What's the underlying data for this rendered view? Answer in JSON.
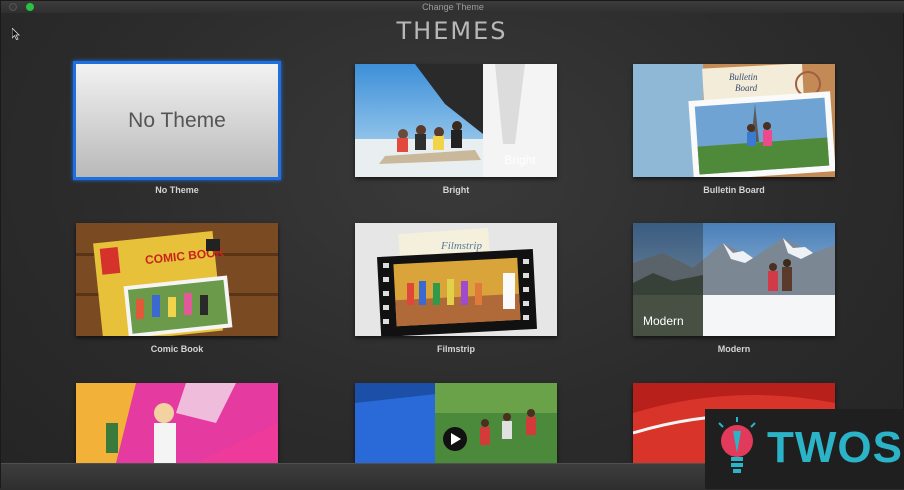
{
  "window": {
    "title": "Change Theme"
  },
  "heading": "THEMES",
  "themes": [
    {
      "label": "No Theme",
      "thumb_text": "No Theme",
      "selected": true
    },
    {
      "label": "Bright",
      "thumb_text": "Bright"
    },
    {
      "label": "Bulletin Board",
      "thumb_text": "Bulletin Board"
    },
    {
      "label": "Comic Book",
      "thumb_text": "COMIC BOOK"
    },
    {
      "label": "Filmstrip",
      "thumb_text": "Filmstrip"
    },
    {
      "label": "Modern",
      "thumb_text": "Modern"
    },
    {
      "label": ""
    },
    {
      "label": ""
    },
    {
      "label": ""
    }
  ],
  "watermark": {
    "text": "TWOS"
  },
  "colors": {
    "selection": "#1e6fe0",
    "watermark": "#2bb3c8",
    "background": "#2b2b2b"
  }
}
